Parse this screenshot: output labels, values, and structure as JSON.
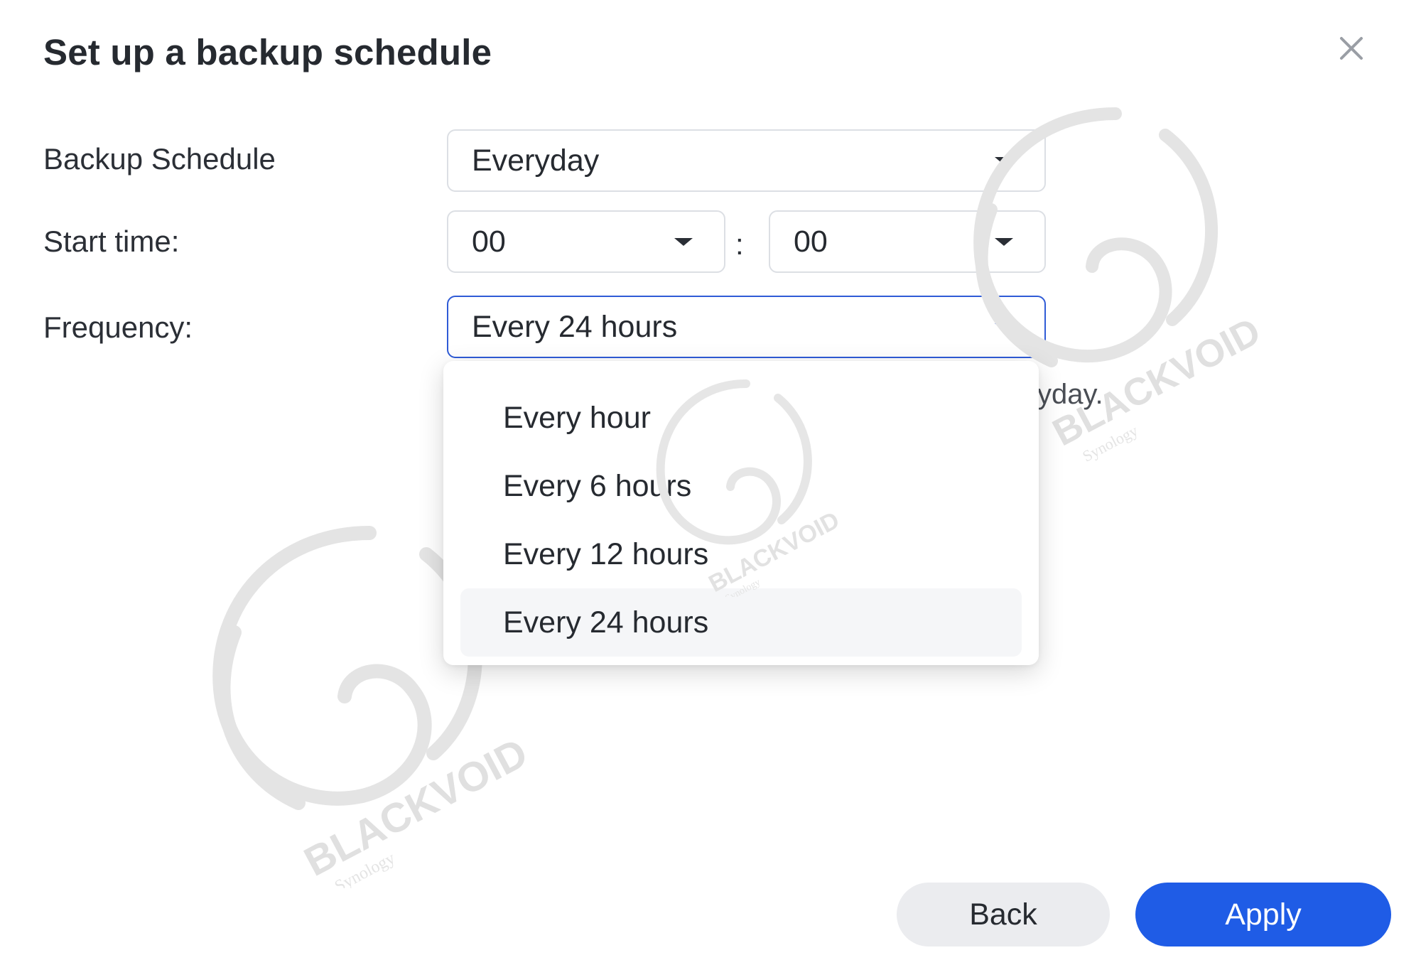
{
  "dialog": {
    "title": "Set up a backup schedule",
    "close_icon": "close-icon"
  },
  "form": {
    "schedule_label": "Backup Schedule",
    "schedule_value": "Everyday",
    "start_time_label": "Start time:",
    "start_hour": "00",
    "time_separator": ":",
    "start_minute": "00",
    "frequency_label": "Frequency:",
    "frequency_value": "Every 24 hours",
    "hint_partial": "yday."
  },
  "frequency_menu": {
    "options": [
      "Every hour",
      "Every 6 hours",
      "Every 12 hours",
      "Every 24 hours"
    ],
    "selected": "Every 24 hours"
  },
  "footer": {
    "back_label": "Back",
    "apply_label": "Apply"
  },
  "watermark": {
    "brand": "BLACKVOID",
    "sub": "Synology"
  },
  "colors": {
    "accent": "#1f5ce6",
    "focus_border": "#2f5bd6",
    "secondary_button": "#ebecef"
  }
}
